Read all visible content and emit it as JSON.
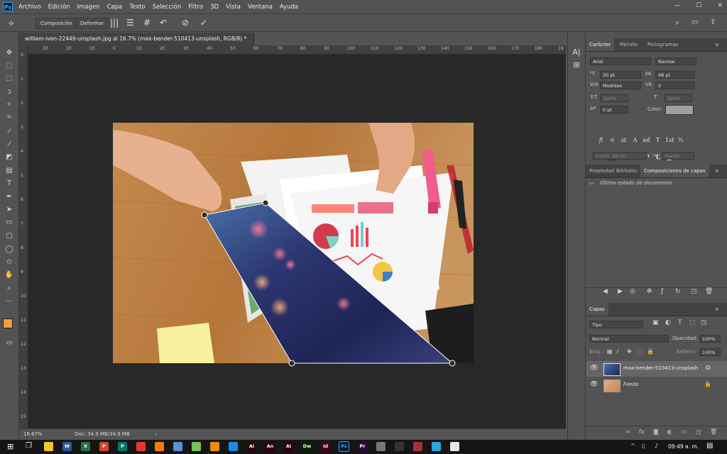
{
  "app": {
    "logo": "Ps"
  },
  "menu": [
    "Archivo",
    "Edición",
    "Imagen",
    "Capa",
    "Texto",
    "Selección",
    "Filtro",
    "3D",
    "Vista",
    "Ventana",
    "Ayuda"
  ],
  "window_controls": {
    "minimize": "—",
    "maximize": "☐",
    "close": "✕"
  },
  "options_bar": {
    "composicion": "Composición",
    "deformar": "Deformar"
  },
  "document": {
    "tab_title": "william-iven-22449-unsplash.jpg al 16.7% (max-bender-510413-unsplash, RGB/8) *",
    "zoom": "16.67%",
    "doc_info": "Doc: 34.9 MB/34.9 MB"
  },
  "ruler": {
    "h_ticks": [
      "30",
      "20",
      "10",
      "0",
      "10",
      "20",
      "30",
      "40",
      "50",
      "60",
      "70",
      "80",
      "90",
      "100",
      "110",
      "120",
      "130",
      "140",
      "150",
      "160",
      "170",
      "180",
      "19"
    ],
    "v_ticks": [
      "0",
      "1",
      "2",
      "3",
      "4",
      "5",
      "6",
      "7",
      "8",
      "9",
      "10",
      "11",
      "12",
      "13",
      "14",
      "15"
    ]
  },
  "character_panel": {
    "tabs": [
      "Carácter",
      "Párrafo",
      "Pictogramas"
    ],
    "font_family": "Arial",
    "font_style": "Narrow",
    "font_size": "30 pt",
    "leading": "48 pt",
    "kerning": "Medidas",
    "tracking": "0",
    "vscale": "100%",
    "hscale": "100%",
    "baseline": "0 pt",
    "color_label": "Color:",
    "color_value": "#a0a0a0",
    "style_buttons": [
      "T",
      "T",
      "TT",
      "Tt",
      "T¹",
      "T,",
      "T",
      "T"
    ],
    "ot_buttons": [
      "fi",
      "σ",
      "st",
      "A",
      "ad",
      "T",
      "1st",
      "½"
    ],
    "language": "Inglés: EE.UU.",
    "antialias_label": "aa",
    "antialias": "Fuerte"
  },
  "comp_panel": {
    "tabs": [
      "Propiedad",
      "Bibliotec",
      "Composiciones de capas"
    ],
    "item": "Último estado de documento"
  },
  "layers_panel": {
    "title": "Capas",
    "filter": "Tipo",
    "blend_mode": "Normal",
    "opacity_label": "Opacidad:",
    "opacity": "100%",
    "lock_label": "Bloq.:",
    "fill_label": "Relleno:",
    "fill": "100%",
    "layers": [
      {
        "name": "max-bender-510413-unsplash",
        "italic": false
      },
      {
        "name": "Fondo",
        "italic": true
      }
    ]
  },
  "taskbar": {
    "time": "09:49 a. m.",
    "apps": [
      {
        "label": "",
        "color": "#f3c623"
      },
      {
        "label": "W",
        "color": "#2b579a"
      },
      {
        "label": "X",
        "color": "#217346"
      },
      {
        "label": "P",
        "color": "#d24726"
      },
      {
        "label": "P",
        "color": "#077568"
      },
      {
        "label": "",
        "color": "#e53935"
      },
      {
        "label": "",
        "color": "#ff7a00"
      },
      {
        "label": "",
        "color": "#5d8fd6"
      },
      {
        "label": "",
        "color": "#78c257"
      },
      {
        "label": "",
        "color": "#f18a00"
      },
      {
        "label": "",
        "color": "#1e88e5"
      },
      {
        "label": "Ai",
        "color": "#330000"
      },
      {
        "label": "An",
        "color": "#330000"
      },
      {
        "label": "Ai",
        "color": "#330000"
      },
      {
        "label": "Dw",
        "color": "#072401"
      },
      {
        "label": "Id",
        "color": "#49021f"
      },
      {
        "label": "Ps",
        "color": "#001d34"
      },
      {
        "label": "Pr",
        "color": "#2a0a3e"
      },
      {
        "label": "",
        "color": "#777777"
      },
      {
        "label": "",
        "color": "#333333"
      },
      {
        "label": "",
        "color": "#a83232"
      },
      {
        "label": "",
        "color": "#2fa5dd"
      },
      {
        "label": "",
        "color": "#e6e6e6"
      }
    ]
  }
}
